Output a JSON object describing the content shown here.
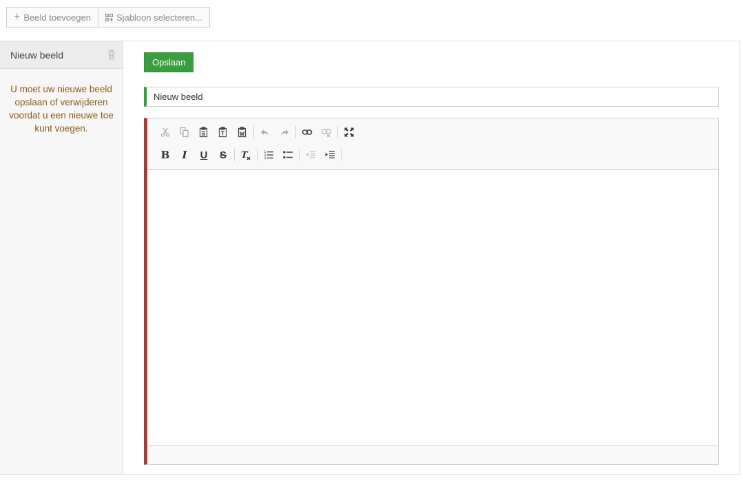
{
  "toolbar": {
    "add_label": "Beeld toevoegen",
    "template_label": "Sjabloon selecteren..."
  },
  "sidebar": {
    "items": [
      {
        "label": "Nieuw beeld"
      }
    ],
    "note": "U moet uw nieuwe beeld opslaan of verwijderen voordat u een nieuwe toe kunt voegen."
  },
  "main": {
    "save_label": "Opslaan",
    "title_value": "Nieuw beeld"
  },
  "editor": {
    "row1": [
      "cut-icon",
      "copy-icon",
      "paste-icon",
      "paste-text-icon",
      "paste-word-icon",
      "undo-icon",
      "redo-icon",
      "link-icon",
      "unlink-icon",
      "maximize-icon"
    ],
    "row2": [
      "bold-icon",
      "italic-icon",
      "underline-icon",
      "strikethrough-icon",
      "remove-format-icon",
      "numbered-list-icon",
      "bulleted-list-icon",
      "decrease-indent-icon",
      "increase-indent-icon"
    ],
    "format_glyphs": {
      "bold": "B",
      "italic": "I",
      "underline": "U",
      "strike": "S",
      "clear": "T"
    }
  },
  "colors": {
    "accent_green": "#3a9e3f",
    "editor_border_red": "#a83a3a",
    "note_text": "#8b5a1b"
  }
}
